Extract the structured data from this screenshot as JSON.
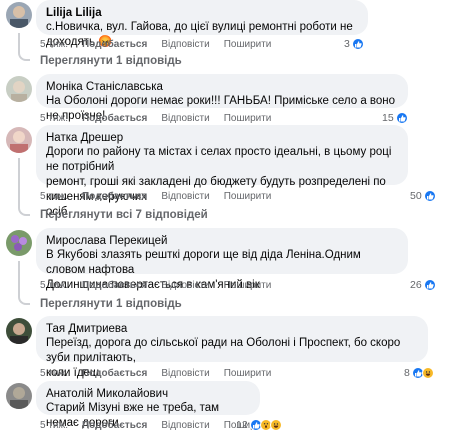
{
  "comments": [
    {
      "author": "Lilija Lilija",
      "text": "с.Новичка, вул. Гайова, до цієї вулиці ремонтні роботи не доходять",
      "emoji": "😡",
      "time": "5 тиж.",
      "like_label": "Подобається",
      "reply_label": "Відповісти",
      "share_label": "Поширити",
      "reaction_count": "3",
      "replies_label": "Переглянути 1 відповідь"
    },
    {
      "author": "Моніка Станіславська",
      "text": "На Оболоні дороги немає роки!!! ГАНЬБА! Приміське село а воно не проїзне!",
      "time": "5 тиж.",
      "like_label": "Подобається",
      "reply_label": "Відповісти",
      "share_label": "Поширити",
      "reaction_count": "15"
    },
    {
      "author": "Натка Дрешер",
      "text_lines": [
        "Дороги по району та містах і селах просто ідеальні, в цьому році не потрібний",
        "ремонт, гроші які закладені до бюджету будуть розпределені по кишеням керуючих",
        "осіб"
      ],
      "time": "5 тиж.",
      "like_label": "Подобається",
      "reply_label": "Відповісти",
      "share_label": "Поширити",
      "reaction_count": "50",
      "replies_label": "Переглянути всі 7 відповідей"
    },
    {
      "author": "Мирослава Перекицей",
      "text_lines": [
        "В Якубові злазять решткі дороги ще від діда Леніна.Одним словом нафтова",
        "Долинщина повертається в кам'яний вік"
      ],
      "time": "5 тиж.",
      "like_label": "Подобається",
      "reply_label": "Відповісти",
      "share_label": "Поширити",
      "reaction_count": "26",
      "replies_label": "Переглянути 1 відповідь"
    },
    {
      "author": "Тая Дмитриева",
      "text_lines": [
        "Переїзд, дорога до сільської ради на Оболоні і Проспект, бо скоро зуби прилітають,",
        "коли їдеш"
      ],
      "time": "5 тиж.",
      "like_label": "Подобається",
      "reply_label": "Відповісти",
      "share_label": "Поширити",
      "reaction_count": "8"
    },
    {
      "author": "Анатолій Миколайович",
      "text": "Старий Мізуні вже не треба, там немає дороги.",
      "time": "5 тиж.",
      "like_label": "Подобається",
      "reply_label": "Відповісти",
      "share_label": "Поширити",
      "reaction_count": "12"
    }
  ],
  "icons": {
    "like": "like-icon",
    "haha": "haha-icon",
    "wow": "wow-icon",
    "reply_arrow": "reply-arrow-icon"
  },
  "colors": {
    "bubble": "#f0f2f5",
    "meta": "#65676b",
    "like_blue": "#1877f2",
    "emoji_yellow": "#f7b928"
  }
}
